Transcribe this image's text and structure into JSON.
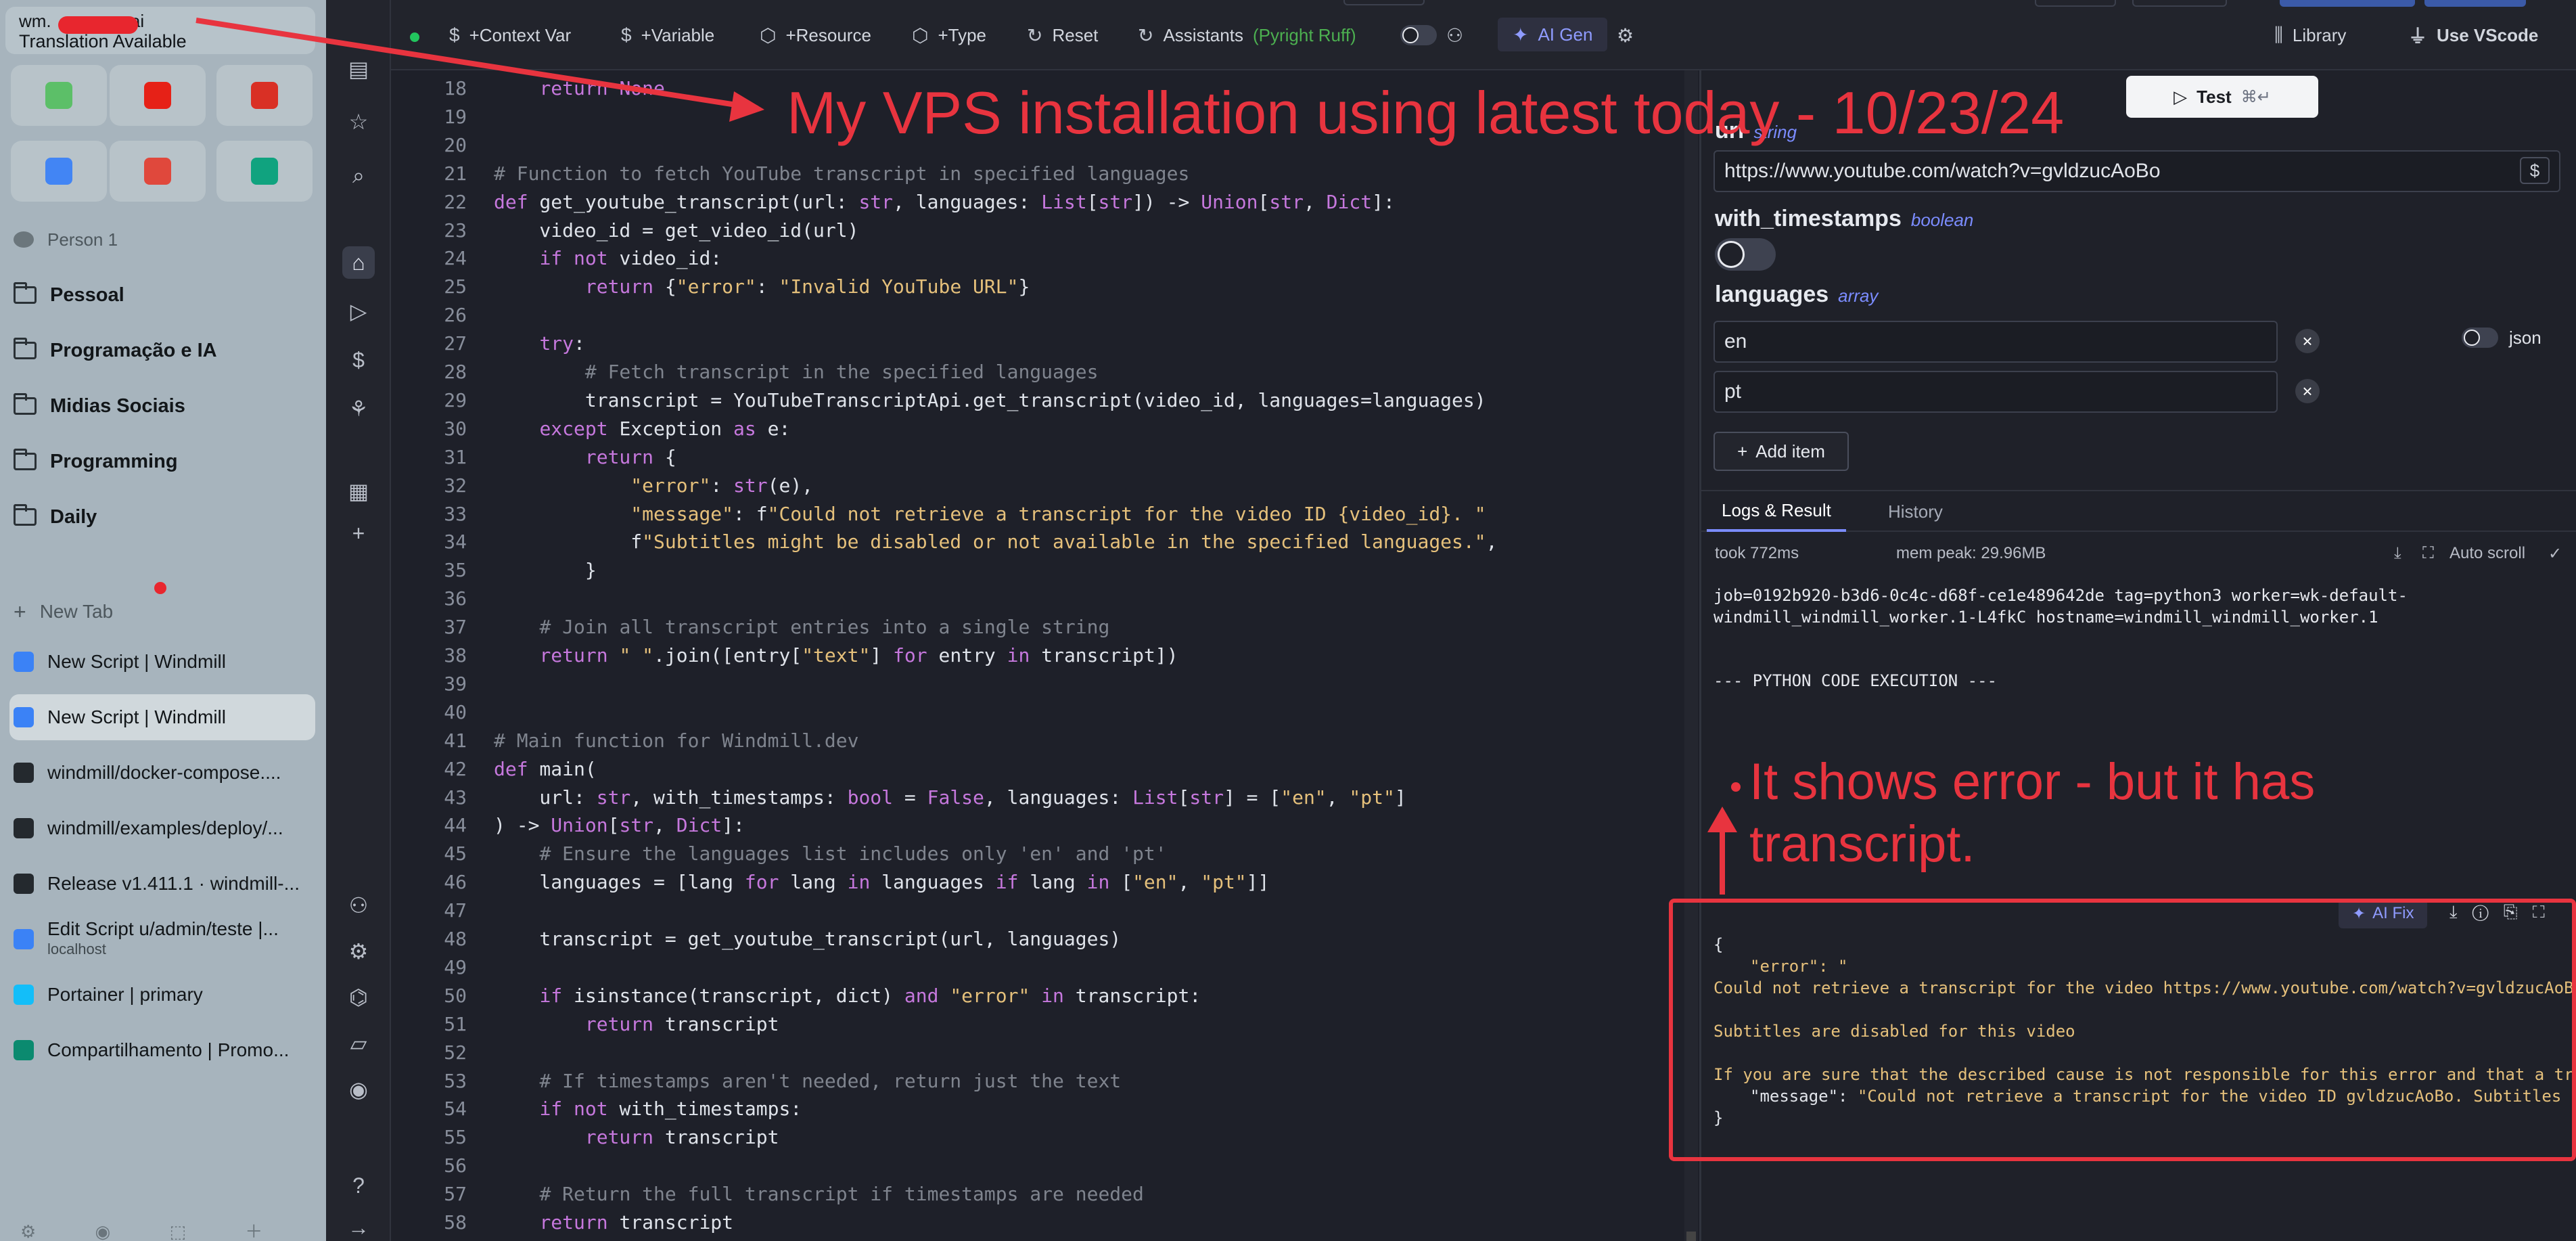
{
  "browser": {
    "url_prefix": "wm.",
    "url_suffix": ".ai",
    "translation": "Translation Available",
    "favorites": [
      {
        "icon": "checklist-icon",
        "color": "#5cbf68"
      },
      {
        "icon": "youtube-icon",
        "color": "#e62117"
      },
      {
        "icon": "gmail-icon",
        "color": "#d93025"
      },
      {
        "icon": "calendar-icon",
        "color": "#4285f4"
      },
      {
        "icon": "app-icon",
        "color": "#e0483c"
      },
      {
        "icon": "chatgpt-icon",
        "color": "#10a37f"
      }
    ],
    "profile": "Person 1",
    "folders": [
      "Pessoal",
      "Programação e IA",
      "Midias Sociais",
      "Programming",
      "Daily"
    ],
    "new_tab": "New Tab",
    "tabs": [
      {
        "title": "New Script | Windmill",
        "icon": "windmill-icon",
        "color": "#3b82f6"
      },
      {
        "title": "New Script | Windmill",
        "icon": "windmill-icon",
        "color": "#3b82f6",
        "active": true
      },
      {
        "title": "windmill/docker-compose....",
        "icon": "github-icon",
        "color": "#24292e"
      },
      {
        "title": "windmill/examples/deploy/...",
        "icon": "github-icon",
        "color": "#24292e"
      },
      {
        "title": "Release v1.411.1 · windmill-...",
        "icon": "github-icon",
        "color": "#24292e"
      },
      {
        "title": "Edit Script u/admin/teste |...",
        "subtitle": "localhost",
        "icon": "windmill-icon",
        "color": "#3b82f6"
      },
      {
        "title": "Portainer | primary",
        "icon": "portainer-icon",
        "color": "#13bef9"
      },
      {
        "title": "Compartilhamento | Promo...",
        "icon": "app-icon",
        "color": "#0b8a6f"
      }
    ]
  },
  "toolbar": {
    "context_var": "+Context Var",
    "variable": "+Variable",
    "resource": "+Resource",
    "type": "+Type",
    "reset": "Reset",
    "assistants": "Assistants",
    "assistants_sub": "(Pyright Ruff)",
    "ai_gen": "AI Gen",
    "library": "Library",
    "use_vscode": "Use VScode"
  },
  "editor": {
    "lines": [
      {
        "n": "18",
        "t": "    return None"
      },
      {
        "n": "19",
        "t": ""
      },
      {
        "n": "20",
        "t": ""
      },
      {
        "n": "21",
        "t": "# Function to fetch YouTube transcript in specified languages"
      },
      {
        "n": "22",
        "t": "def get_youtube_transcript(url: str, languages: List[str]) -> Union[str, Dict]:"
      },
      {
        "n": "23",
        "t": "    video_id = get_video_id(url)"
      },
      {
        "n": "24",
        "t": "    if not video_id:"
      },
      {
        "n": "25",
        "t": "        return {\"error\": \"Invalid YouTube URL\"}"
      },
      {
        "n": "26",
        "t": ""
      },
      {
        "n": "27",
        "t": "    try:"
      },
      {
        "n": "28",
        "t": "        # Fetch transcript in the specified languages"
      },
      {
        "n": "29",
        "t": "        transcript = YouTubeTranscriptApi.get_transcript(video_id, languages=languages)"
      },
      {
        "n": "30",
        "t": "    except Exception as e:"
      },
      {
        "n": "31",
        "t": "        return {"
      },
      {
        "n": "32",
        "t": "            \"error\": str(e),"
      },
      {
        "n": "33",
        "t": "            \"message\": f\"Could not retrieve a transcript for the video ID {video_id}. \""
      },
      {
        "n": "34",
        "t": "            f\"Subtitles might be disabled or not available in the specified languages.\","
      },
      {
        "n": "35",
        "t": "        }"
      },
      {
        "n": "36",
        "t": ""
      },
      {
        "n": "37",
        "t": "    # Join all transcript entries into a single string"
      },
      {
        "n": "38",
        "t": "    return \" \".join([entry[\"text\"] for entry in transcript])"
      },
      {
        "n": "39",
        "t": ""
      },
      {
        "n": "40",
        "t": ""
      },
      {
        "n": "41",
        "t": "# Main function for Windmill.dev"
      },
      {
        "n": "42",
        "t": "def main("
      },
      {
        "n": "43",
        "t": "    url: str, with_timestamps: bool = False, languages: List[str] = [\"en\", \"pt\"]"
      },
      {
        "n": "44",
        "t": ") -> Union[str, Dict]:"
      },
      {
        "n": "45",
        "t": "    # Ensure the languages list includes only 'en' and 'pt'"
      },
      {
        "n": "46",
        "t": "    languages = [lang for lang in languages if lang in [\"en\", \"pt\"]]"
      },
      {
        "n": "47",
        "t": ""
      },
      {
        "n": "48",
        "t": "    transcript = get_youtube_transcript(url, languages)"
      },
      {
        "n": "49",
        "t": ""
      },
      {
        "n": "50",
        "t": "    if isinstance(transcript, dict) and \"error\" in transcript:"
      },
      {
        "n": "51",
        "t": "        return transcript"
      },
      {
        "n": "52",
        "t": ""
      },
      {
        "n": "53",
        "t": "    # If timestamps aren't needed, return just the text"
      },
      {
        "n": "54",
        "t": "    if not with_timestamps:"
      },
      {
        "n": "55",
        "t": "        return transcript"
      },
      {
        "n": "56",
        "t": ""
      },
      {
        "n": "57",
        "t": "    # Return the full transcript if timestamps are needed"
      },
      {
        "n": "58",
        "t": "    return transcript"
      }
    ]
  },
  "form": {
    "test_label": "Test",
    "test_shortcut": "⌘↵",
    "url_label": "url",
    "url_type": "string",
    "url_value": "https://www.youtube.com/watch?v=gvldzucAoBo",
    "with_timestamps_label": "with_timestamps",
    "with_timestamps_type": "boolean",
    "languages_label": "languages",
    "languages_type": "array",
    "languages": [
      "en",
      "pt"
    ],
    "json_label": "json",
    "add_item": "Add item"
  },
  "logs": {
    "tab_logs": "Logs & Result",
    "tab_history": "History",
    "took": "took 772ms",
    "mem_peak": "mem peak: 29.96MB",
    "auto_scroll": "Auto scroll",
    "job_line1": "job=0192b920-b3d6-0c4c-d68f-ce1e489642de tag=python3 worker=wk-default-",
    "job_line2": "windmill_windmill_worker.1-L4fkC hostname=windmill_windmill_worker.1",
    "exec": "--- PYTHON CODE EXECUTION ---",
    "ai_fix": "AI Fix"
  },
  "result": {
    "open": "{",
    "error_key": "\"error\": \"",
    "line1": "Could not retrieve a transcript for the video https://www.youtube.com/watch?v=gvldzucAoBo",
    "line2": "Subtitles are disabled for this video",
    "line3": "If you are sure that the described cause is not responsible for this error and that a tr",
    "message_key": "\"message\":",
    "message_val": "\"Could not retrieve a transcript for the video ID gvldzucAoBo. Subtitles",
    "close": "}"
  },
  "annotations": {
    "title": "My VPS installation using latest today - 10/23/24",
    "note_line1": "It shows error - but it has",
    "note_line2": "transcript.",
    "color": "#e8343f"
  }
}
